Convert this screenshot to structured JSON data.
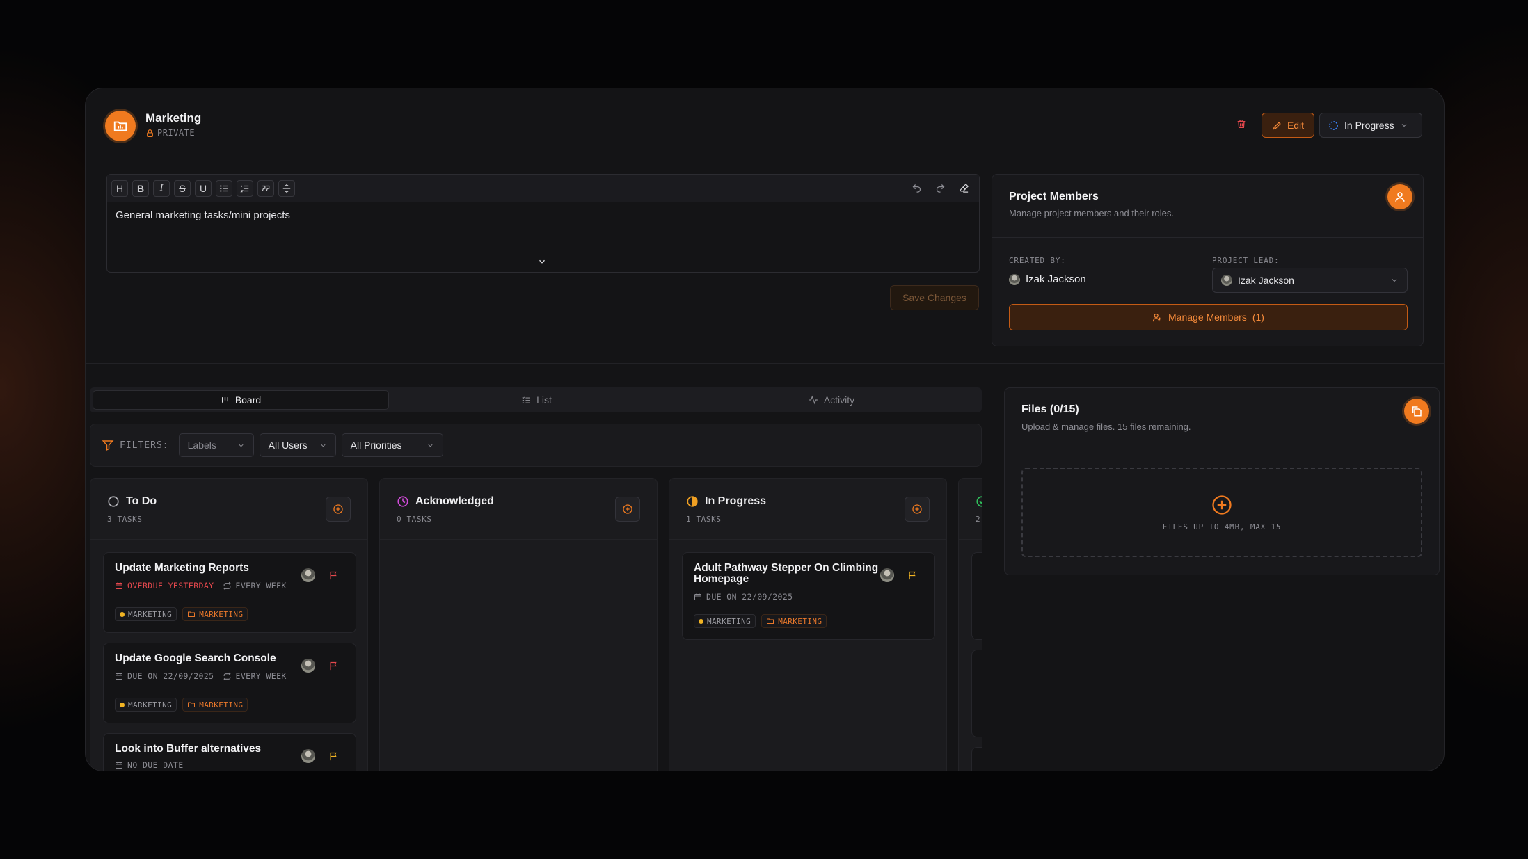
{
  "project": {
    "name": "Marketing",
    "visibility": "PRIVATE",
    "status": "In Progress",
    "edit_label": "Edit"
  },
  "editor": {
    "content": "General marketing tasks/mini projects",
    "toolbar": [
      "H",
      "B",
      "I",
      "S",
      "U"
    ],
    "save_label": "Save Changes"
  },
  "members": {
    "title": "Project Members",
    "subtitle": "Manage project members and their roles.",
    "created_by_label": "CREATED BY:",
    "created_by": "Izak Jackson",
    "lead_label": "PROJECT LEAD:",
    "lead": "Izak Jackson",
    "manage_label": "Manage Members",
    "manage_count": "(1)"
  },
  "tabs": [
    {
      "label": "Board",
      "active": true
    },
    {
      "label": "List",
      "active": false
    },
    {
      "label": "Activity",
      "active": false
    }
  ],
  "filters": {
    "label": "FILTERS:",
    "labels": "Labels",
    "users": "All Users",
    "priorities": "All Priorities"
  },
  "columns": [
    {
      "title": "To Do",
      "count": "3 TASKS",
      "color": "#b8b8be",
      "cards": [
        {
          "title": "Update Marketing Reports",
          "due": "OVERDUE YESTERDAY",
          "overdue": true,
          "repeat": "EVERY WEEK",
          "tag1": "MARKETING",
          "tag2": "MARKETING",
          "flag_color": "#e5484d"
        },
        {
          "title": "Update Google Search Console",
          "due": "DUE ON 22/09/2025",
          "overdue": false,
          "repeat": "EVERY WEEK",
          "tag1": "MARKETING",
          "tag2": "MARKETING",
          "flag_color": "#e5484d"
        },
        {
          "title": "Look into Buffer alternatives",
          "due": "NO DUE DATE",
          "overdue": false,
          "repeat": "",
          "tag1": "",
          "tag2": "",
          "flag_color": "#f0b323"
        }
      ]
    },
    {
      "title": "Acknowledged",
      "count": "0 TASKS",
      "color": "#d04ad8",
      "cards": []
    },
    {
      "title": "In Progress",
      "count": "1 TASKS",
      "color": "#f0a023",
      "cards": [
        {
          "title": "Adult Pathway Stepper On Climbing Homepage",
          "due": "DUE ON 22/09/2025",
          "overdue": false,
          "repeat": "",
          "tag1": "MARKETING",
          "tag2": "MARKETING",
          "flag_color": "#f0b323"
        }
      ]
    },
    {
      "title": "",
      "count": "2",
      "color": "#2fbf5b",
      "cards": []
    }
  ],
  "files": {
    "title": "Files (0/15)",
    "subtitle": "Upload & manage files. 15 files remaining.",
    "hint": "FILES UP TO 4MB, MAX 15"
  },
  "colors": {
    "accent": "#f07a1f",
    "background": "#141416",
    "danger": "#e5484d"
  }
}
